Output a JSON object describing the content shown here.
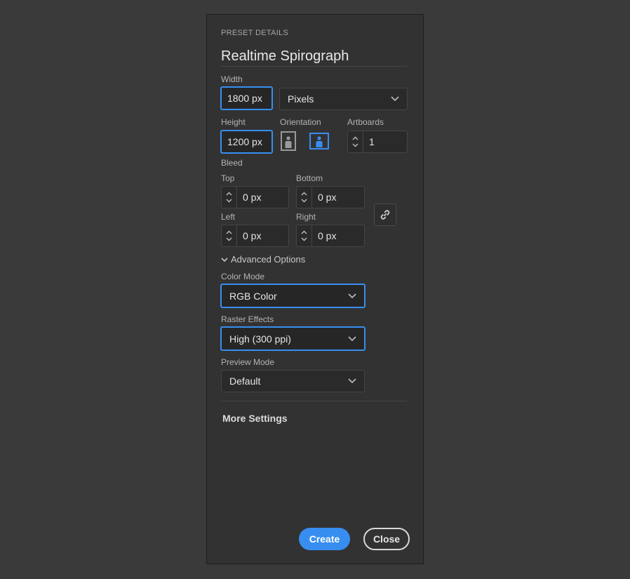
{
  "panel": {
    "section_title": "PRESET DETAILS",
    "preset_name": "Realtime Spirograph"
  },
  "size": {
    "width_label": "Width",
    "width_value": "1800 px",
    "units_value": "Pixels",
    "height_label": "Height",
    "height_value": "1200 px",
    "orientation_label": "Orientation",
    "artboards_label": "Artboards",
    "artboards_value": "1"
  },
  "bleed": {
    "label": "Bleed",
    "top_label": "Top",
    "top_value": "0 px",
    "bottom_label": "Bottom",
    "bottom_value": "0 px",
    "left_label": "Left",
    "left_value": "0 px",
    "right_label": "Right",
    "right_value": "0 px"
  },
  "advanced": {
    "toggle_label": "Advanced Options",
    "color_mode_label": "Color Mode",
    "color_mode_value": "RGB Color",
    "raster_label": "Raster Effects",
    "raster_value": "High (300 ppi)",
    "preview_label": "Preview Mode",
    "preview_value": "Default"
  },
  "more_settings": "More Settings",
  "buttons": {
    "create": "Create",
    "close": "Close"
  },
  "colors": {
    "accent": "#378ef0",
    "background": "#3a3a3a",
    "panel": "#323232"
  },
  "icons": {
    "chevron": "chevron-down-icon",
    "link": "link-icon",
    "portrait": "portrait-orientation-icon",
    "landscape": "landscape-orientation-icon"
  }
}
